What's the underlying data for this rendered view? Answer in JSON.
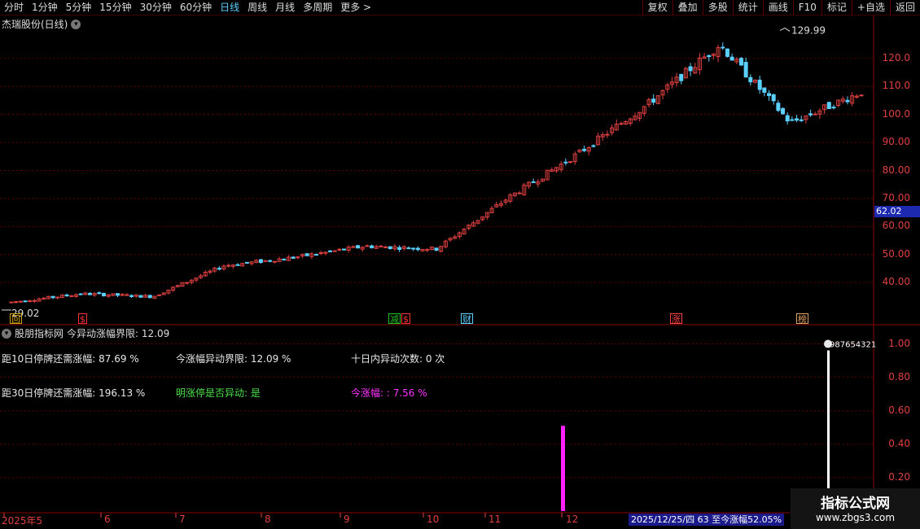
{
  "toolbar": {
    "periods": [
      "分时",
      "1分钟",
      "5分钟",
      "15分钟",
      "30分钟",
      "60分钟",
      "日线",
      "周线",
      "月线",
      "多周期",
      "更多 >"
    ],
    "active_index": 6,
    "tools": [
      "复权",
      "叠加",
      "多股",
      "统计",
      "画线",
      "F10",
      "标记",
      "+自选",
      "返回"
    ]
  },
  "chart": {
    "title": "杰瑞股份(日线)",
    "high_label": "129.99",
    "low_label": "29.02",
    "current_price": "62.02",
    "y_ticks": [
      "120.0",
      "110.0",
      "100.0",
      "90.00",
      "80.00",
      "70.00",
      "60.00",
      "50.00",
      "40.00"
    ],
    "markers": [
      {
        "text": "回",
        "color": "#d0a000"
      },
      {
        "text": "$",
        "color": "#ff3030"
      },
      {
        "text": "减",
        "color": "#20c020"
      },
      {
        "text": "$",
        "color": "#ff3030"
      },
      {
        "text": "财",
        "color": "#5ad0ff"
      },
      {
        "text": "涨",
        "color": "#ff4040"
      },
      {
        "text": "榜",
        "color": "#e0a060"
      }
    ]
  },
  "chart_data": [
    {
      "type": "candlestick",
      "title": "杰瑞股份(日线)",
      "ylim": [
        29,
        131
      ],
      "y_ticks": [
        40,
        50,
        60,
        70,
        80,
        90,
        100,
        110,
        120
      ],
      "high": 129.99,
      "low": 29.02,
      "x_months": [
        "2025年5",
        "6",
        "7",
        "8",
        "9",
        "10",
        "11",
        "12"
      ],
      "close_trend": [
        {
          "m": "5",
          "v": 33
        },
        {
          "m": "6",
          "v": 36
        },
        {
          "m": "7",
          "v": 35
        },
        {
          "m": "8",
          "v": 46
        },
        {
          "m": "9",
          "v": 49
        },
        {
          "m": "10",
          "v": 53
        },
        {
          "m": "11",
          "v": 52
        },
        {
          "m": "12",
          "v": 70
        },
        {
          "m": "12b",
          "v": 86
        },
        {
          "m": "12c",
          "v": 104
        },
        {
          "m": "12d",
          "v": 125
        },
        {
          "m": "12e",
          "v": 97
        },
        {
          "m": "12f",
          "v": 108
        }
      ]
    },
    {
      "type": "bar",
      "title": "今异动涨幅界限",
      "ylim": [
        0,
        1.1
      ],
      "y_ticks": [
        0.2,
        0.4,
        0.6,
        0.8,
        1.0
      ],
      "values": [
        {
          "label": "magenta",
          "value": 0.51
        },
        {
          "label": "white",
          "value": 1.0
        }
      ]
    }
  ],
  "indicator": {
    "name": "股朋指标网",
    "param_label": "今异动涨幅界限: 12.09",
    "r1c1": "距10日停牌还需涨幅: 87.69 %",
    "r1c2": "今涨幅异动界限: 12.09 %",
    "r1c3": "十日内异动次数: 0 次",
    "r2c1": "距30日停牌还需涨幅: 196.13 %",
    "r2c2": "明涨停是否异动: 是",
    "r2c3": "今涨幅: : 7.56 %",
    "flag": "987654321",
    "y_ticks": [
      "1.00",
      "0.80",
      "0.60",
      "0.40",
      "0.20"
    ]
  },
  "timeline": {
    "months": [
      "2025年5",
      "6",
      "7",
      "8",
      "9",
      "10",
      "11",
      "12"
    ],
    "status": "2025/12/25/四 63 至今涨幅52.05%"
  },
  "watermark": {
    "line1": "指标公式网",
    "line2": "www.zbgs3.com"
  },
  "colors": {
    "red": "#e04040",
    "cyan": "#5ad0ff",
    "grid": "#5a0000"
  }
}
